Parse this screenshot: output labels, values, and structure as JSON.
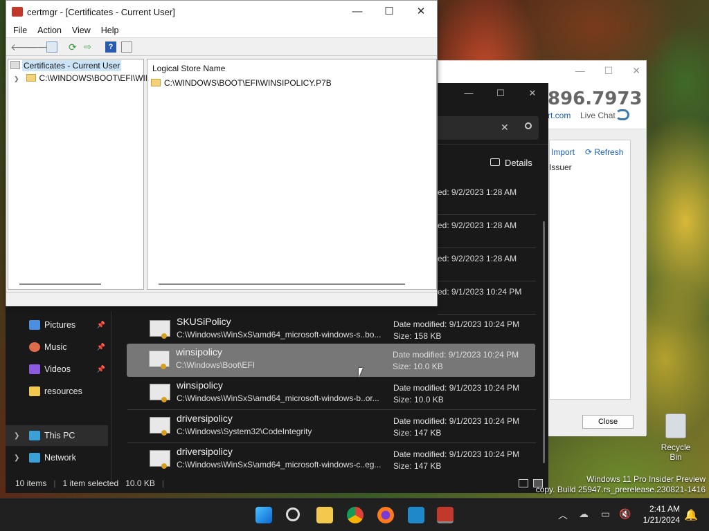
{
  "support_window": {
    "phone": "896.7973",
    "url_fragment": "rt.com",
    "live_chat": "Live Chat",
    "import_label": "Import",
    "refresh_label": "Refresh",
    "issuer_header": "Issuer",
    "close_label": "Close"
  },
  "explorer": {
    "details_label": "Details",
    "nav": [
      {
        "label": "Pictures",
        "icon": "pictures-icon",
        "color": "#4a8fe0"
      },
      {
        "label": "Music",
        "icon": "music-icon",
        "color": "#e06a4a"
      },
      {
        "label": "Videos",
        "icon": "videos-icon",
        "color": "#8a5ae0"
      },
      {
        "label": "resources",
        "icon": "folder-icon",
        "color": "#f2c94c"
      },
      {
        "label": "This PC",
        "icon": "computer-icon",
        "color": "#3aa0d8"
      },
      {
        "label": "Network",
        "icon": "network-icon",
        "color": "#3aa0d8"
      }
    ],
    "partial_rows": [
      "ed: 9/2/2023 1:28 AM",
      "ed: 9/2/2023 1:28 AM",
      "ed: 9/2/2023 1:28 AM",
      "ed: 9/1/2023 10:24 PM"
    ],
    "files": [
      {
        "name": "SKUSiPolicy",
        "path": "C:\\Windows\\WinSxS\\amd64_microsoft-windows-s..bo...",
        "modified": "Date modified: 9/1/2023 10:24 PM",
        "size": "Size: 158 KB"
      },
      {
        "name": "winsipolicy",
        "path": "C:\\Windows\\Boot\\EFI",
        "modified": "Date modified: 9/1/2023 10:24 PM",
        "size": "Size: 10.0 KB"
      },
      {
        "name": "winsipolicy",
        "path": "C:\\Windows\\WinSxS\\amd64_microsoft-windows-b..or...",
        "modified": "Date modified: 9/1/2023 10:24 PM",
        "size": "Size: 10.0 KB"
      },
      {
        "name": "driversipolicy",
        "path": "C:\\Windows\\System32\\CodeIntegrity",
        "modified": "Date modified: 9/1/2023 10:24 PM",
        "size": "Size: 147 KB"
      },
      {
        "name": "driversipolicy",
        "path": "C:\\Windows\\WinSxS\\amd64_microsoft-windows-c..eg...",
        "modified": "Date modified: 9/1/2023 10:24 PM",
        "size": "Size: 147 KB"
      }
    ],
    "status": {
      "items": "10 items",
      "selected": "1 item selected",
      "size": "10.0 KB"
    }
  },
  "certmgr": {
    "title": "certmgr - [Certificates - Current User]",
    "menu": [
      "File",
      "Action",
      "View",
      "Help"
    ],
    "tree_root": "Certificates - Current User",
    "tree_child": "C:\\WINDOWS\\BOOT\\EFI\\WIN",
    "column_header": "Logical Store Name",
    "store_item": "C:\\WINDOWS\\BOOT\\EFI\\WINSIPOLICY.P7B"
  },
  "desktop": {
    "recycle_bin": "Recycle Bin",
    "watermark_line1": "Windows 11 Pro Insider Preview",
    "watermark_line2": "copy. Build 25947.rs_prerelease.230821-1416"
  },
  "taskbar": {
    "time": "2:41 AM",
    "date": "1/21/2024"
  }
}
